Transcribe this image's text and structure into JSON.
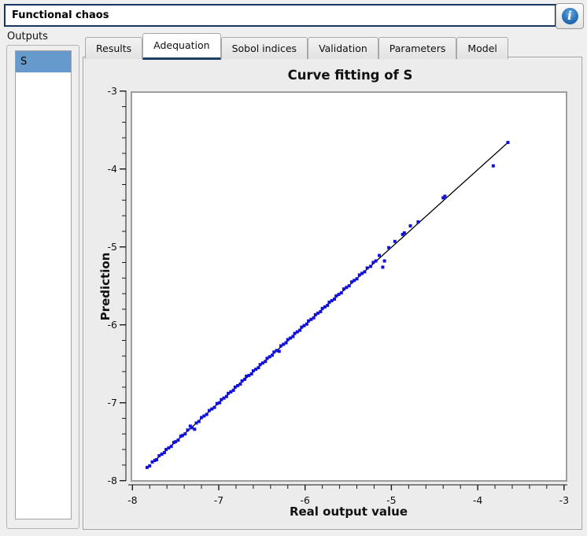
{
  "header": {
    "analysis_name": "Functional chaos",
    "info_icon": "info-icon"
  },
  "outputs_panel": {
    "label": "Outputs",
    "items": [
      {
        "label": "S",
        "selected": true
      }
    ]
  },
  "tabs": [
    {
      "label": "Results",
      "active": false
    },
    {
      "label": "Adequation",
      "active": true
    },
    {
      "label": "Sobol indices",
      "active": false
    },
    {
      "label": "Validation",
      "active": false
    },
    {
      "label": "Parameters",
      "active": false
    },
    {
      "label": "Model",
      "active": false
    }
  ],
  "colors": {
    "accent_navy": "#17375e",
    "tab_underline": "#1b3e63",
    "selection_blue": "#6699cc",
    "marker_blue": "#1010d8",
    "fit_line": "#000000",
    "info_blue": "#2a72b8",
    "canvas_border": "#9e9e9e"
  },
  "chart_data": {
    "type": "scatter",
    "title": "Curve fitting of S",
    "xlabel": "Real output value",
    "ylabel": "Prediction",
    "xlim": [
      -8,
      -3
    ],
    "ylim": [
      -8,
      -3
    ],
    "x_ticks": [
      -8,
      -7,
      -6,
      -5,
      -4,
      -3
    ],
    "y_ticks": [
      -3,
      -4,
      -5,
      -6,
      -7,
      -8
    ],
    "minor_tick_step": 0.2,
    "grid": false,
    "legend": "none",
    "marker": "square",
    "fit_line": {
      "from": [
        -7.72,
        -7.72
      ],
      "to": [
        -3.65,
        -3.66
      ]
    },
    "points": [
      [
        -7.83,
        -7.83
      ],
      [
        -7.8,
        -7.81
      ],
      [
        -7.77,
        -7.76
      ],
      [
        -7.74,
        -7.74
      ],
      [
        -7.72,
        -7.73
      ],
      [
        -7.69,
        -7.68
      ],
      [
        -7.66,
        -7.66
      ],
      [
        -7.63,
        -7.64
      ],
      [
        -7.61,
        -7.6
      ],
      [
        -7.58,
        -7.58
      ],
      [
        -7.55,
        -7.56
      ],
      [
        -7.52,
        -7.51
      ],
      [
        -7.5,
        -7.5
      ],
      [
        -7.47,
        -7.48
      ],
      [
        -7.44,
        -7.43
      ],
      [
        -7.42,
        -7.42
      ],
      [
        -7.39,
        -7.4
      ],
      [
        -7.36,
        -7.35
      ],
      [
        -7.33,
        -7.3
      ],
      [
        -7.31,
        -7.32
      ],
      [
        -7.28,
        -7.34
      ],
      [
        -7.26,
        -7.26
      ],
      [
        -7.23,
        -7.24
      ],
      [
        -7.2,
        -7.19
      ],
      [
        -7.17,
        -7.17
      ],
      [
        -7.14,
        -7.15
      ],
      [
        -7.11,
        -7.1
      ],
      [
        -7.08,
        -7.08
      ],
      [
        -7.05,
        -7.06
      ],
      [
        -7.02,
        -7.01
      ],
      [
        -6.99,
        -7.0
      ],
      [
        -6.97,
        -6.96
      ],
      [
        -6.94,
        -6.94
      ],
      [
        -6.91,
        -6.92
      ],
      [
        -6.89,
        -6.88
      ],
      [
        -6.86,
        -6.86
      ],
      [
        -6.83,
        -6.84
      ],
      [
        -6.81,
        -6.8
      ],
      [
        -6.78,
        -6.78
      ],
      [
        -6.75,
        -6.76
      ],
      [
        -6.73,
        -6.72
      ],
      [
        -6.7,
        -6.7
      ],
      [
        -6.68,
        -6.66
      ],
      [
        -6.65,
        -6.65
      ],
      [
        -6.62,
        -6.63
      ],
      [
        -6.6,
        -6.59
      ],
      [
        -6.57,
        -6.57
      ],
      [
        -6.54,
        -6.55
      ],
      [
        -6.52,
        -6.51
      ],
      [
        -6.49,
        -6.49
      ],
      [
        -6.46,
        -6.47
      ],
      [
        -6.44,
        -6.43
      ],
      [
        -6.41,
        -6.41
      ],
      [
        -6.38,
        -6.39
      ],
      [
        -6.36,
        -6.35
      ],
      [
        -6.33,
        -6.33
      ],
      [
        -6.3,
        -6.34
      ],
      [
        -6.28,
        -6.27
      ],
      [
        -6.25,
        -6.25
      ],
      [
        -6.22,
        -6.23
      ],
      [
        -6.2,
        -6.19
      ],
      [
        -6.17,
        -6.17
      ],
      [
        -6.14,
        -6.15
      ],
      [
        -6.12,
        -6.11
      ],
      [
        -6.09,
        -6.09
      ],
      [
        -6.06,
        -6.07
      ],
      [
        -6.04,
        -6.03
      ],
      [
        -6.01,
        -6.01
      ],
      [
        -5.98,
        -5.99
      ],
      [
        -5.96,
        -5.95
      ],
      [
        -5.93,
        -5.93
      ],
      [
        -5.9,
        -5.91
      ],
      [
        -5.88,
        -5.87
      ],
      [
        -5.85,
        -5.85
      ],
      [
        -5.82,
        -5.83
      ],
      [
        -5.8,
        -5.79
      ],
      [
        -5.77,
        -5.77
      ],
      [
        -5.74,
        -5.75
      ],
      [
        -5.72,
        -5.71
      ],
      [
        -5.69,
        -5.69
      ],
      [
        -5.66,
        -5.67
      ],
      [
        -5.64,
        -5.63
      ],
      [
        -5.61,
        -5.61
      ],
      [
        -5.58,
        -5.59
      ],
      [
        -5.55,
        -5.54
      ],
      [
        -5.52,
        -5.52
      ],
      [
        -5.49,
        -5.5
      ],
      [
        -5.46,
        -5.45
      ],
      [
        -5.43,
        -5.43
      ],
      [
        -5.4,
        -5.41
      ],
      [
        -5.37,
        -5.36
      ],
      [
        -5.34,
        -5.34
      ],
      [
        -5.31,
        -5.32
      ],
      [
        -5.28,
        -5.27
      ],
      [
        -5.24,
        -5.25
      ],
      [
        -5.21,
        -5.2
      ],
      [
        -5.18,
        -5.18
      ],
      [
        -5.14,
        -5.11
      ],
      [
        -5.1,
        -5.26
      ],
      [
        -5.08,
        -5.18
      ],
      [
        -5.03,
        -5.01
      ],
      [
        -4.96,
        -4.93
      ],
      [
        -4.87,
        -4.84
      ],
      [
        -4.85,
        -4.82
      ],
      [
        -4.78,
        -4.73
      ],
      [
        -4.69,
        -4.68
      ],
      [
        -4.4,
        -4.37
      ],
      [
        -4.38,
        -4.35
      ],
      [
        -3.82,
        -3.96
      ],
      [
        -3.65,
        -3.66
      ]
    ]
  }
}
